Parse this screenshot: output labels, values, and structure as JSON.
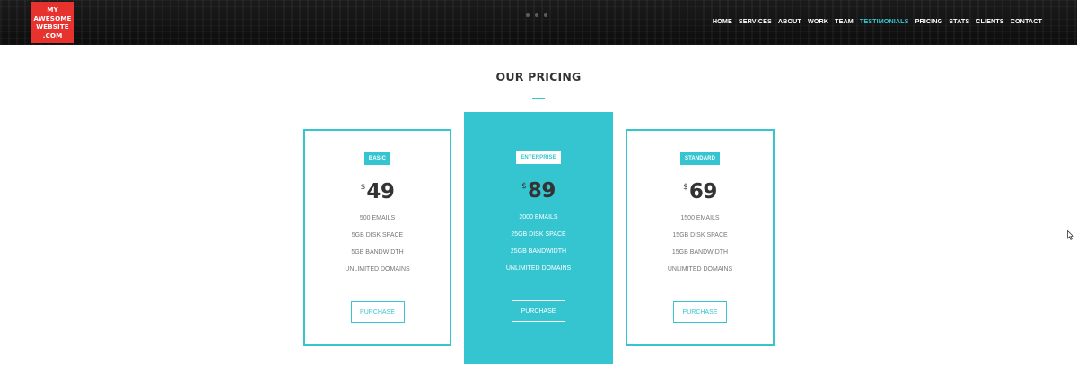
{
  "header": {
    "logo_text": "MY\nAWESOME\nWEBSITE\n.COM",
    "nav": [
      {
        "label": "HOME",
        "active": false
      },
      {
        "label": "SERVICES",
        "active": false
      },
      {
        "label": "ABOUT",
        "active": false
      },
      {
        "label": "WORK",
        "active": false
      },
      {
        "label": "TEAM",
        "active": false
      },
      {
        "label": "TESTIMONIALS",
        "active": true
      },
      {
        "label": "PRICING",
        "active": false
      },
      {
        "label": "STATS",
        "active": false
      },
      {
        "label": "CLIENTS",
        "active": false
      },
      {
        "label": "CONTACT",
        "active": false
      }
    ]
  },
  "pricing": {
    "title": "OUR PRICING",
    "plans": [
      {
        "name": "BASIC",
        "currency": "$",
        "price": "49",
        "featured": false,
        "features": [
          "500 EMAILS",
          "5GB DISK SPACE",
          "5GB BANDWIDTH",
          "UNLIMITED DOMAINS"
        ],
        "button_label": "PURCHASE"
      },
      {
        "name": "ENTERPRISE",
        "currency": "$",
        "price": "89",
        "featured": true,
        "features": [
          "2000 EMAILS",
          "25GB DISK SPACE",
          "25GB BANDWIDTH",
          "UNLIMITED DOMAINS"
        ],
        "button_label": "PURCHASE"
      },
      {
        "name": "STANDARD",
        "currency": "$",
        "price": "69",
        "featured": false,
        "features": [
          "1500 EMAILS",
          "15GB DISK SPACE",
          "15GB BANDWIDTH",
          "UNLIMITED DOMAINS"
        ],
        "button_label": "PURCHASE"
      }
    ]
  },
  "colors": {
    "accent": "#35c5d1",
    "logo": "#e8322e",
    "header_bg": "#111111",
    "text_dark": "#333333"
  }
}
